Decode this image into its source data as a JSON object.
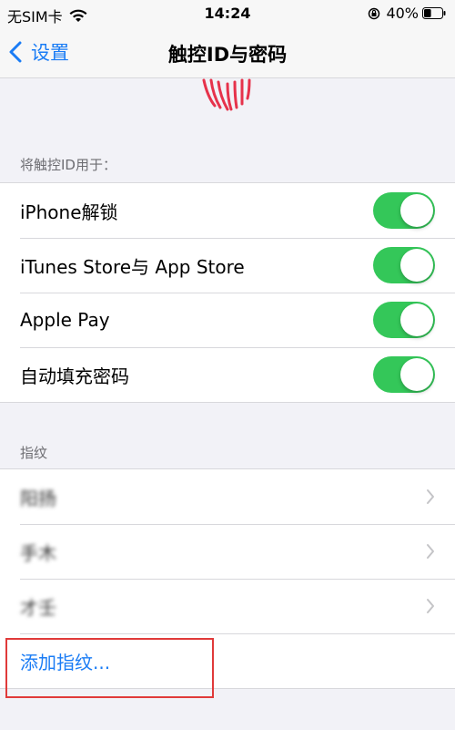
{
  "status_bar": {
    "carrier": "无SIM卡",
    "time": "14:24",
    "battery_percent": "40%",
    "battery_level": 0.4
  },
  "nav": {
    "back_label": "设置",
    "title": "触控ID与密码"
  },
  "touch_id_section": {
    "header": "将触控ID用于：",
    "items": [
      {
        "label": "iPhone解锁",
        "enabled": true
      },
      {
        "label": "iTunes Store与 App Store",
        "enabled": true
      },
      {
        "label": "Apple Pay",
        "enabled": true
      },
      {
        "label": "自动填充密码",
        "enabled": true
      }
    ]
  },
  "fingerprints_section": {
    "header": "指纹",
    "items": [
      {
        "label": "阳扬"
      },
      {
        "label": "手木"
      },
      {
        "label": "才壬"
      }
    ],
    "add_label": "添加指纹..."
  },
  "colors": {
    "accent": "#1a7cf5",
    "toggle_on": "#34c759",
    "fingerprint": "#e6324b",
    "highlight": "#e03a3a"
  }
}
